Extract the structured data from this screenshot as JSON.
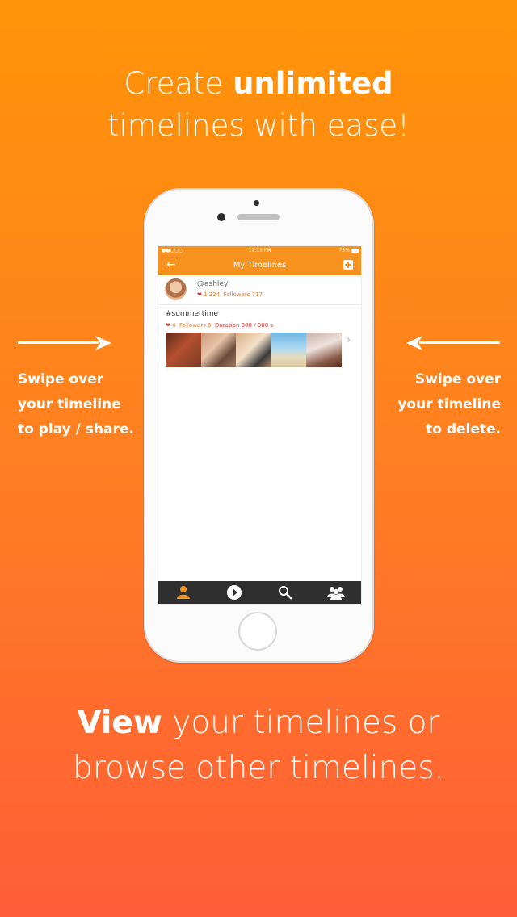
{
  "headline_top": {
    "line1_regular": "Create ",
    "line1_bold": "unlimited",
    "line2": "timelines with ease!"
  },
  "headline_bottom": {
    "line1_bold": "View",
    "line1_regular": " your timelines or",
    "line2": "browse other timelines."
  },
  "left_note": [
    "Swipe over",
    "your timeline",
    "to play / share."
  ],
  "right_note": [
    "Swipe over",
    "your timeline",
    "to delete."
  ],
  "phone_screen": {
    "status_bar": {
      "left": "●●○○○",
      "time": "12:13 PM",
      "battery": "73%"
    },
    "nav": {
      "title": "My Timelines",
      "back_icon": "arrow-left-icon",
      "add_icon": "plus-square-icon"
    },
    "profile": {
      "username": "@ashley",
      "likes": "1,224",
      "followers_label": "Followers",
      "followers": "717"
    },
    "timeline": {
      "name": "#summertime",
      "likes": "4",
      "followers_label": "Followers",
      "followers": "5",
      "duration_label": "Duration",
      "duration": "300 / 300 s"
    },
    "tabbar": [
      "person-icon",
      "play-icon",
      "search-icon",
      "group-icon"
    ]
  },
  "colors": {
    "brand_orange": "#f7921e",
    "tabbar": "#2f2f2f",
    "bg_top": "#ff9408",
    "bg_bottom": "#ff5d38"
  }
}
